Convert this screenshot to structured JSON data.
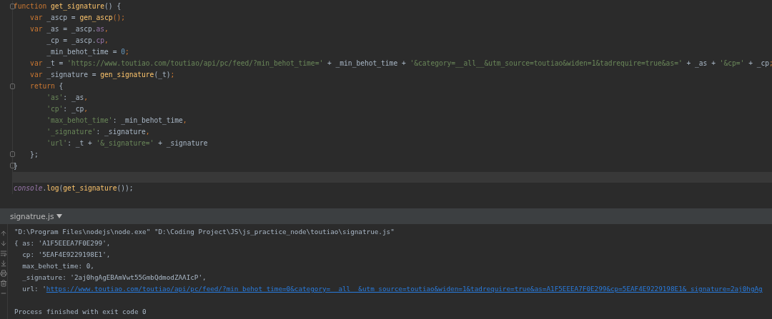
{
  "editor": {
    "lines": [
      {
        "current": false,
        "fold": true,
        "tokens": [
          {
            "kind": "kw",
            "text": "function"
          },
          {
            "kind": "fn",
            "text": " get_signature"
          },
          {
            "kind": "plain",
            "text": "() {"
          }
        ]
      },
      {
        "current": false,
        "fold": false,
        "tokens": [
          {
            "kind": "kw",
            "text": "    var"
          },
          {
            "kind": "plain",
            "text": " _ascp = "
          },
          {
            "kind": "fn",
            "text": "gen_ascp"
          },
          {
            "kind": "kw",
            "text": "();"
          }
        ]
      },
      {
        "current": false,
        "fold": false,
        "tokens": [
          {
            "kind": "kw",
            "text": "    var"
          },
          {
            "kind": "plain",
            "text": " _as = _ascp."
          },
          {
            "kind": "prop",
            "text": "as"
          },
          {
            "kind": "kw",
            "text": ","
          }
        ]
      },
      {
        "current": false,
        "fold": false,
        "tokens": [
          {
            "kind": "plain",
            "text": "        _cp = _ascp."
          },
          {
            "kind": "prop",
            "text": "cp"
          },
          {
            "kind": "kw",
            "text": ","
          }
        ]
      },
      {
        "current": false,
        "fold": false,
        "tokens": [
          {
            "kind": "plain",
            "text": "        _min_behot_time = "
          },
          {
            "kind": "num",
            "text": "0"
          },
          {
            "kind": "kw",
            "text": ";"
          }
        ]
      },
      {
        "current": false,
        "fold": false,
        "tokens": [
          {
            "kind": "kw",
            "text": "    var"
          },
          {
            "kind": "plain",
            "text": " _t = "
          },
          {
            "kind": "str",
            "text": "'https://www.toutiao.com/toutiao/api/pc/feed/?min_behot_time='"
          },
          {
            "kind": "plain",
            "text": " + _min_behot_time + "
          },
          {
            "kind": "str",
            "text": "'&category=__all__&utm_source=toutiao&widen=1&tadrequire=true&as='"
          },
          {
            "kind": "plain",
            "text": " + _as + "
          },
          {
            "kind": "str",
            "text": "'&cp='"
          },
          {
            "kind": "plain",
            "text": " + _cp"
          },
          {
            "kind": "kw",
            "text": ";"
          }
        ]
      },
      {
        "current": false,
        "fold": false,
        "tokens": [
          {
            "kind": "kw",
            "text": "    var"
          },
          {
            "kind": "plain",
            "text": " _signature = "
          },
          {
            "kind": "fn",
            "text": "gen_signature"
          },
          {
            "kind": "plain",
            "text": "(_t)"
          },
          {
            "kind": "kw",
            "text": ";"
          }
        ]
      },
      {
        "current": false,
        "fold": true,
        "tokens": [
          {
            "kind": "kw",
            "text": "    return"
          },
          {
            "kind": "plain",
            "text": " {"
          }
        ]
      },
      {
        "current": false,
        "fold": false,
        "tokens": [
          {
            "kind": "str",
            "text": "        'as'"
          },
          {
            "kind": "plain",
            "text": ": _as"
          },
          {
            "kind": "kw",
            "text": ","
          }
        ]
      },
      {
        "current": false,
        "fold": false,
        "tokens": [
          {
            "kind": "str",
            "text": "        'cp'"
          },
          {
            "kind": "plain",
            "text": ": _cp"
          },
          {
            "kind": "kw",
            "text": ","
          }
        ]
      },
      {
        "current": false,
        "fold": false,
        "tokens": [
          {
            "kind": "str",
            "text": "        'max_behot_time'"
          },
          {
            "kind": "plain",
            "text": ": _min_behot_time"
          },
          {
            "kind": "kw",
            "text": ","
          }
        ]
      },
      {
        "current": false,
        "fold": false,
        "tokens": [
          {
            "kind": "str",
            "text": "        '_signature'"
          },
          {
            "kind": "plain",
            "text": ": _signature"
          },
          {
            "kind": "kw",
            "text": ","
          }
        ]
      },
      {
        "current": false,
        "fold": false,
        "tokens": [
          {
            "kind": "str",
            "text": "        'url'"
          },
          {
            "kind": "plain",
            "text": ": _t + "
          },
          {
            "kind": "str",
            "text": "'&_signature='"
          },
          {
            "kind": "plain",
            "text": " + _signature"
          }
        ]
      },
      {
        "current": false,
        "fold": true,
        "tokens": [
          {
            "kind": "plain",
            "text": "    };"
          }
        ]
      },
      {
        "current": false,
        "fold": true,
        "tokens": [
          {
            "kind": "plain",
            "text": "}"
          }
        ]
      },
      {
        "current": true,
        "fold": false
      },
      {
        "current": false,
        "fold": false,
        "tokens": [
          {
            "kind": "global",
            "text": "console"
          },
          {
            "kind": "plain",
            "text": "."
          },
          {
            "kind": "fn",
            "text": "log"
          },
          {
            "kind": "plain",
            "text": "("
          },
          {
            "kind": "fn",
            "text": "get_signature"
          },
          {
            "kind": "plain",
            "text": "());"
          }
        ]
      }
    ]
  },
  "run_panel": {
    "tab": "signatrue.js",
    "output": [
      {
        "kind": "command",
        "text": "\"D:\\Program Files\\nodejs\\node.exe\" \"D:\\Coding Project\\JS\\js_practice_node\\toutiao\\signatrue.js\""
      },
      {
        "kind": "output",
        "text": "{ as: 'A1F5EEEA7F0E299',"
      },
      {
        "kind": "output",
        "text": "  cp: '5EAF4E9229198E1',"
      },
      {
        "kind": "output",
        "text": "  max_behot_time: 0,"
      },
      {
        "kind": "output",
        "text": "  _signature: '2aj0hgAgEBAmVwt55GmbQdmodZAAIcP',"
      },
      {
        "kind": "output",
        "text": "  url: '",
        "link": "https://www.toutiao.com/toutiao/api/pc/feed/?min_behot_time=0&category=__all__&utm_source=toutiao&widen=1&tadrequire=true&as=A1F5EEEA7F0E299&cp=5EAF4E9229198E1&_signature=2aj0hgAg"
      },
      {
        "kind": "exit",
        "text": "Process finished with exit code 0"
      }
    ]
  }
}
